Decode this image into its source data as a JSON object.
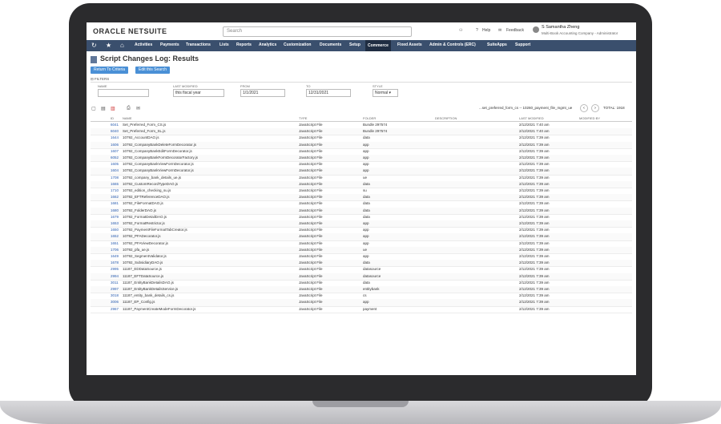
{
  "app": {
    "logo": "ORACLE NETSUITE",
    "search_placeholder": "Search",
    "help": "Help",
    "feedback": "Feedback",
    "user_name": "S Samantha Zheng",
    "user_role": "Multi-Book Accounting Company - Administrator"
  },
  "nav": [
    "Activities",
    "Payments",
    "Transactions",
    "Lists",
    "Reports",
    "Analytics",
    "Customization",
    "Documents",
    "Setup",
    "Commerce",
    "Fixed Assets",
    "Admin & Controls (ERC)",
    "SuiteApps",
    "Support"
  ],
  "page": {
    "title": "Script Changes Log: Results",
    "return_btn": "Return To Criteria",
    "edit_btn": "Edit this Search",
    "filters_label": "FILTERS"
  },
  "filters": {
    "name_label": "NAME",
    "last_modified_label": "LAST MODIFIED",
    "last_modified_value": "this fiscal year",
    "from_label": "FROM",
    "from_value": "1/1/2021",
    "to_label": "TO",
    "to_value": "12/31/2021",
    "style_label": "STYLE",
    "style_value": "Normal"
  },
  "pager": {
    "range": "...set_preferred_form_cs -- 10260_payment_file_mgmt_ue",
    "total": "TOTAL: 1918"
  },
  "columns": [
    "ID",
    "NAME",
    "TYPE",
    "FOLDER",
    "DESCRIPTION",
    "LAST MODIFIED",
    "MODIFIED BY"
  ],
  "rows": [
    {
      "id": "6041",
      "name": "Set_Preferred_Form_CS.js",
      "type": "JavaScript File",
      "folder": "Bundle 297574",
      "modified": "2/12/2021 7:40 am"
    },
    {
      "id": "6040",
      "name": "Set_Preferred_Form_SL.js",
      "type": "JavaScript File",
      "folder": "Bundle 297574",
      "modified": "2/12/2021 7:40 am"
    },
    {
      "id": "1644",
      "name": "10792_AccountDAO.js",
      "type": "JavaScript File",
      "folder": "data",
      "modified": "2/12/2021 7:39 am"
    },
    {
      "id": "1606",
      "name": "10792_CompanyBankDeleteFormDecorator.js",
      "type": "JavaScript File",
      "folder": "app",
      "modified": "2/12/2021 7:39 am"
    },
    {
      "id": "1607",
      "name": "10792_CompanyBankEditFormDecorator.js",
      "type": "JavaScript File",
      "folder": "app",
      "modified": "2/12/2021 7:39 am"
    },
    {
      "id": "6052",
      "name": "10792_CompanyBankFormDecoratorFactory.js",
      "type": "JavaScript File",
      "folder": "app",
      "modified": "2/12/2021 7:39 am"
    },
    {
      "id": "1605",
      "name": "10792_CompanyBankViewFormDecorator.js",
      "type": "JavaScript File",
      "folder": "app",
      "modified": "2/12/2021 7:39 am"
    },
    {
      "id": "1604",
      "name": "10792_CompanyBankViewFormDecorator.js",
      "type": "JavaScript File",
      "folder": "app",
      "modified": "2/12/2021 7:39 am"
    },
    {
      "id": "1708",
      "name": "10792_company_bank_details_ue.js",
      "type": "JavaScript File",
      "folder": "ue",
      "modified": "2/12/2021 7:39 am"
    },
    {
      "id": "1665",
      "name": "10792_CustomRecordTypeDAO.js",
      "type": "JavaScript File",
      "folder": "data",
      "modified": "2/12/2021 7:39 am"
    },
    {
      "id": "1710",
      "name": "10792_edition_checking_su.js",
      "type": "JavaScript File",
      "folder": "su",
      "modified": "2/12/2021 7:39 am"
    },
    {
      "id": "1662",
      "name": "10792_EFTReferenceDAO.js",
      "type": "JavaScript File",
      "folder": "data",
      "modified": "2/12/2021 7:39 am"
    },
    {
      "id": "1681",
      "name": "10792_FileFormatDAO.js",
      "type": "JavaScript File",
      "folder": "data",
      "modified": "2/12/2021 7:39 am"
    },
    {
      "id": "1680",
      "name": "10792_FolderDAO.js",
      "type": "JavaScript File",
      "folder": "data",
      "modified": "2/12/2021 7:39 am"
    },
    {
      "id": "1679",
      "name": "10792_FormatDetailDAO.js",
      "type": "JavaScript File",
      "folder": "data",
      "modified": "2/12/2021 7:39 am"
    },
    {
      "id": "1653",
      "name": "10792_FormatRestrictor.js",
      "type": "JavaScript File",
      "folder": "app",
      "modified": "2/12/2021 7:39 am"
    },
    {
      "id": "1650",
      "name": "10792_PaymentFileFormatTabCreator.js",
      "type": "JavaScript File",
      "folder": "app",
      "modified": "2/12/2021 7:39 am"
    },
    {
      "id": "1652",
      "name": "10792_PFADecorator.js",
      "type": "JavaScript File",
      "folder": "app",
      "modified": "2/12/2021 7:39 am"
    },
    {
      "id": "1651",
      "name": "10792_PFAViewDecorator.js",
      "type": "JavaScript File",
      "folder": "app",
      "modified": "2/12/2021 7:39 am"
    },
    {
      "id": "1706",
      "name": "10792_pfa_ue.js",
      "type": "JavaScript File",
      "folder": "ue",
      "modified": "2/12/2021 7:39 am"
    },
    {
      "id": "1649",
      "name": "10792_SegmentValidator.js",
      "type": "JavaScript File",
      "folder": "app",
      "modified": "2/12/2021 7:39 am"
    },
    {
      "id": "1678",
      "name": "10792_SubsidiaryDAO.js",
      "type": "JavaScript File",
      "folder": "data",
      "modified": "2/12/2021 7:39 am"
    },
    {
      "id": "2995",
      "name": "11187_EDDataSource.js",
      "type": "JavaScript File",
      "folder": "datasource",
      "modified": "2/12/2021 7:39 am"
    },
    {
      "id": "2994",
      "name": "11187_EFTDataSource.js",
      "type": "JavaScript File",
      "folder": "datasource",
      "modified": "2/12/2021 7:39 am"
    },
    {
      "id": "3011",
      "name": "11187_EntityBankDetailsDAO.js",
      "type": "JavaScript File",
      "folder": "data",
      "modified": "2/12/2021 7:39 am"
    },
    {
      "id": "2997",
      "name": "11187_EntityBankDetailsService.js",
      "type": "JavaScript File",
      "folder": "entitybank",
      "modified": "2/12/2021 7:39 am"
    },
    {
      "id": "3018",
      "name": "11187_entity_bank_details_cs.js",
      "type": "JavaScript File",
      "folder": "cs",
      "modified": "2/12/2021 7:39 am"
    },
    {
      "id": "3006",
      "name": "11187_EP_Config.js",
      "type": "JavaScript File",
      "folder": "app",
      "modified": "2/12/2021 7:39 am"
    },
    {
      "id": "2967",
      "name": "11187_PaymentCreateModeFormDecorator.js",
      "type": "JavaScript File",
      "folder": "payment",
      "modified": "2/12/2021 7:39 am"
    }
  ]
}
